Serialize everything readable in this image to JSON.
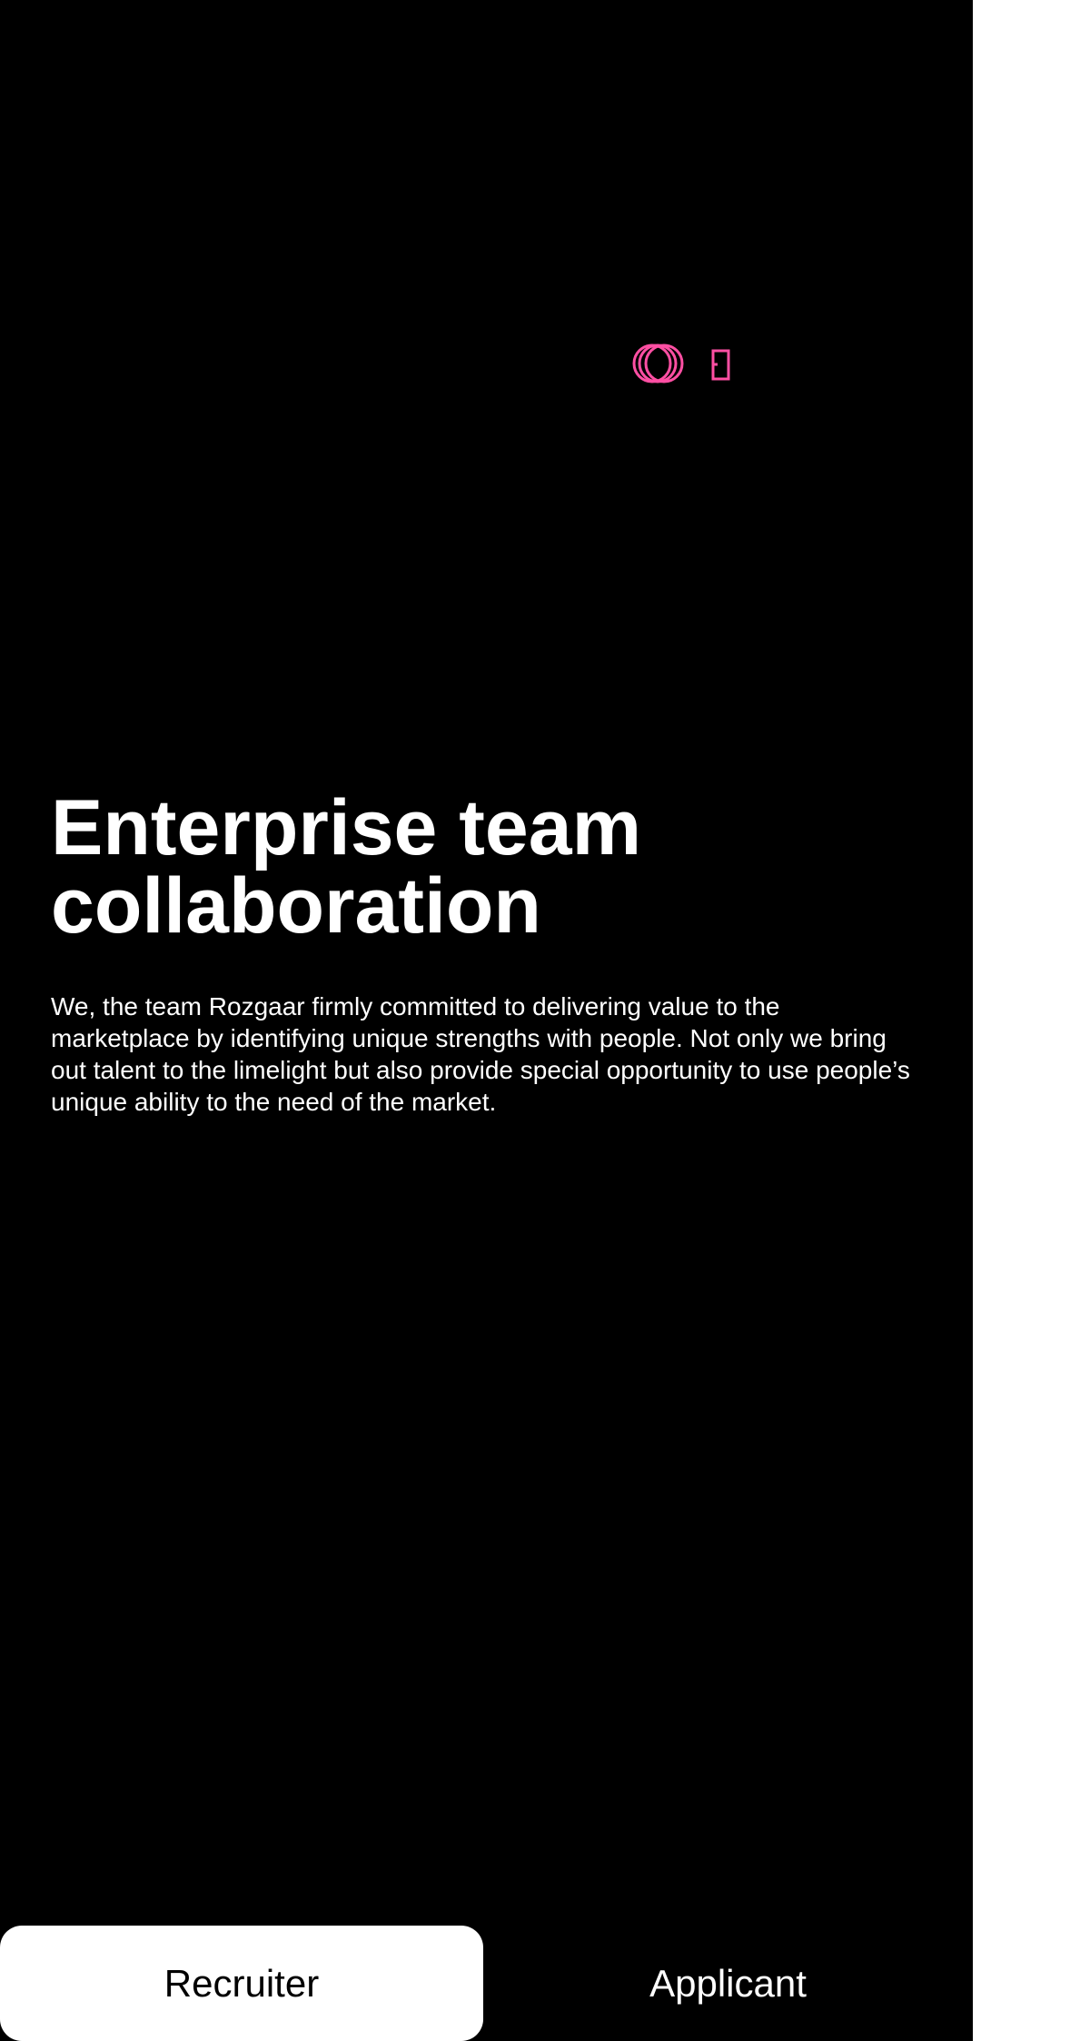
{
  "hero": {
    "decoration_icons": [
      "concentric-circles-icon",
      "door-frame-icon"
    ],
    "colors": {
      "orange": "#FF8A3D",
      "yellow": "#FFC400",
      "pink": "#FF4FA3",
      "magenta": "#E04BC8",
      "background": "#000000"
    }
  },
  "content": {
    "title": "Enterprise team collaboration",
    "description": "We, the team Rozgaar firmly committed to delivering value to the marketplace by identifying unique strengths with people. Not only we bring out talent to the limelight but also provide special opportunity to use people’s unique ability to the need of the market."
  },
  "tabs": {
    "recruiter_label": "Recruiter",
    "applicant_label": "Applicant",
    "selected": "Recruiter"
  }
}
